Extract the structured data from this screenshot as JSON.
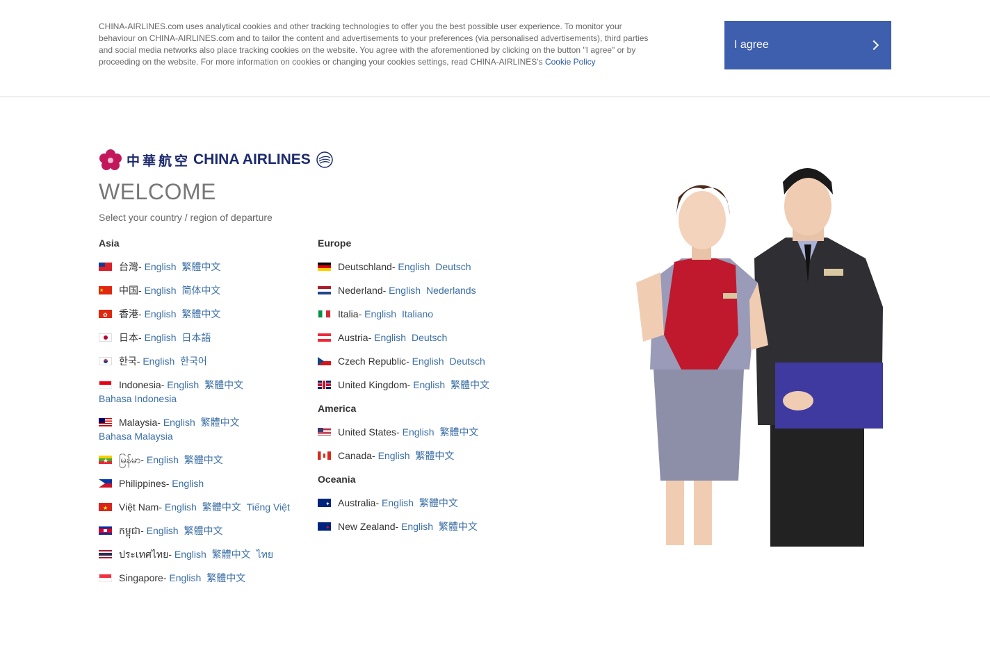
{
  "cookie": {
    "text": "CHINA-AIRLINES.com uses analytical cookies and other tracking technologies to offer you the best possible user experience. To monitor your behaviour on CHINA-AIRLINES.com and to tailor the content and advertisements to your preferences (via personalised advertisements), third parties and social media networks also place tracking cookies on the website. You agree with the aforementioned by clicking on the button \"I agree\" or by proceeding on the website. For more information on cookies or changing your cookies settings, read CHINA-AIRLINES's ",
    "policy_link": "Cookie Policy",
    "agree_label": "I agree"
  },
  "brand": {
    "chinese_name": "中華航空",
    "english_name": "CHINA AIRLINES"
  },
  "page": {
    "title": "WELCOME",
    "subtitle": "Select your country / region of departure"
  },
  "regions": {
    "asia": {
      "title": "Asia",
      "countries": [
        {
          "flag": "taiwan-flag",
          "name": "台灣",
          "links": [
            "English",
            "繁體中文"
          ]
        },
        {
          "flag": "china-flag",
          "name": "中国",
          "links": [
            "English",
            "简体中文"
          ]
        },
        {
          "flag": "hongkong-flag",
          "name": "香港",
          "links": [
            "English",
            "繁體中文"
          ]
        },
        {
          "flag": "japan-flag",
          "name": "日本",
          "links": [
            "English",
            "日本語"
          ]
        },
        {
          "flag": "korea-flag",
          "name": "한국",
          "links": [
            "English",
            "한국어"
          ]
        },
        {
          "flag": "indonesia-flag",
          "name": "Indonesia",
          "links": [
            "English",
            "繁體中文",
            "Bahasa Indonesia"
          ]
        },
        {
          "flag": "malaysia-flag",
          "name": "Malaysia",
          "links": [
            "English",
            "繁體中文",
            "Bahasa Malaysia"
          ]
        },
        {
          "flag": "myanmar-flag",
          "name": "မြန်မာ",
          "links": [
            "English",
            "繁體中文"
          ]
        },
        {
          "flag": "philippines-flag",
          "name": "Philippines",
          "links": [
            "English"
          ]
        },
        {
          "flag": "vietnam-flag",
          "name": "Việt Nam",
          "links": [
            "English",
            "繁體中文",
            "Tiếng Việt"
          ]
        },
        {
          "flag": "cambodia-flag",
          "name": "កម្ពុជា",
          "links": [
            "English",
            "繁體中文"
          ]
        },
        {
          "flag": "thailand-flag",
          "name": "ประเทศไทย",
          "links": [
            "English",
            "繁體中文",
            "ไทย"
          ]
        },
        {
          "flag": "singapore-flag",
          "name": "Singapore",
          "links": [
            "English",
            "繁體中文"
          ]
        }
      ]
    },
    "europe": {
      "title": "Europe",
      "countries": [
        {
          "flag": "germany-flag",
          "name": "Deutschland",
          "links": [
            "English",
            "Deutsch"
          ]
        },
        {
          "flag": "netherlands-flag",
          "name": "Nederland",
          "links": [
            "English",
            "Nederlands"
          ]
        },
        {
          "flag": "italy-flag",
          "name": "Italia",
          "links": [
            "English",
            "Italiano"
          ]
        },
        {
          "flag": "austria-flag",
          "name": "Austria",
          "links": [
            "English",
            "Deutsch"
          ]
        },
        {
          "flag": "czech-flag",
          "name": "Czech Republic",
          "links": [
            "English",
            "Deutsch"
          ]
        },
        {
          "flag": "uk-flag",
          "name": "United Kingdom",
          "links": [
            "English",
            "繁體中文"
          ]
        }
      ]
    },
    "america": {
      "title": "America",
      "countries": [
        {
          "flag": "usa-flag",
          "name": "United States",
          "links": [
            "English",
            "繁體中文"
          ]
        },
        {
          "flag": "canada-flag",
          "name": "Canada",
          "links": [
            "English",
            "繁體中文"
          ]
        }
      ]
    },
    "oceania": {
      "title": "Oceania",
      "countries": [
        {
          "flag": "australia-flag",
          "name": "Australia",
          "links": [
            "English",
            "繁體中文"
          ]
        },
        {
          "flag": "newzealand-flag",
          "name": "New Zealand",
          "links": [
            "English",
            "繁體中文"
          ]
        }
      ]
    }
  },
  "colors": {
    "accent": "#3d5fad",
    "link": "#3a6ea5",
    "brand_navy": "#1c2a6e",
    "brand_plum": "#c2185b"
  }
}
